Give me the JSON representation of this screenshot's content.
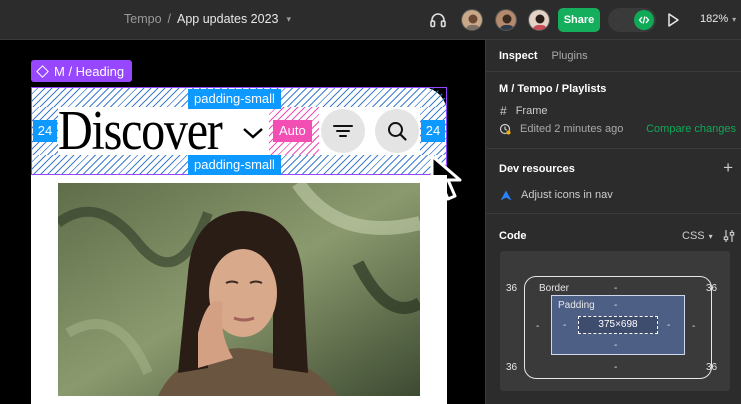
{
  "topbar": {
    "project": "Tempo",
    "separator": "/",
    "file_name": "App updates 2023",
    "share_label": "Share",
    "zoom": "182%",
    "icons": [
      "headphones-icon",
      "chevron-down-icon",
      "code-icon",
      "play-icon"
    ]
  },
  "canvas": {
    "component_label": "M / Heading",
    "heading_text": "Discover",
    "padding_top_label": "padding-small",
    "padding_bottom_label": "padding-small",
    "padding_left_value": "24",
    "padding_right_value": "24",
    "auto_label": "Auto",
    "colors": {
      "selection": "#9747ff",
      "measure": "#0d99ff",
      "auto": "#f24eb4"
    }
  },
  "panel": {
    "tabs": [
      {
        "label": "Inspect",
        "active": true
      },
      {
        "label": "Plugins",
        "active": false
      }
    ],
    "selection_title": "M / Tempo / Playlists",
    "frame_label": "Frame",
    "edited_text": "Edited 2 minutes ago",
    "compare_label": "Compare changes",
    "dev_resources": {
      "title": "Dev resources",
      "add_symbol": "+",
      "item_label": "Adjust icons in nav"
    },
    "code": {
      "title": "Code",
      "language": "CSS"
    },
    "box_model": {
      "border_label": "Border",
      "padding_label": "Padding",
      "content_size": "375×698",
      "corner_tl": "36",
      "corner_tr": "36",
      "corner_bl": "36",
      "corner_br": "36",
      "dash": "-"
    }
  }
}
